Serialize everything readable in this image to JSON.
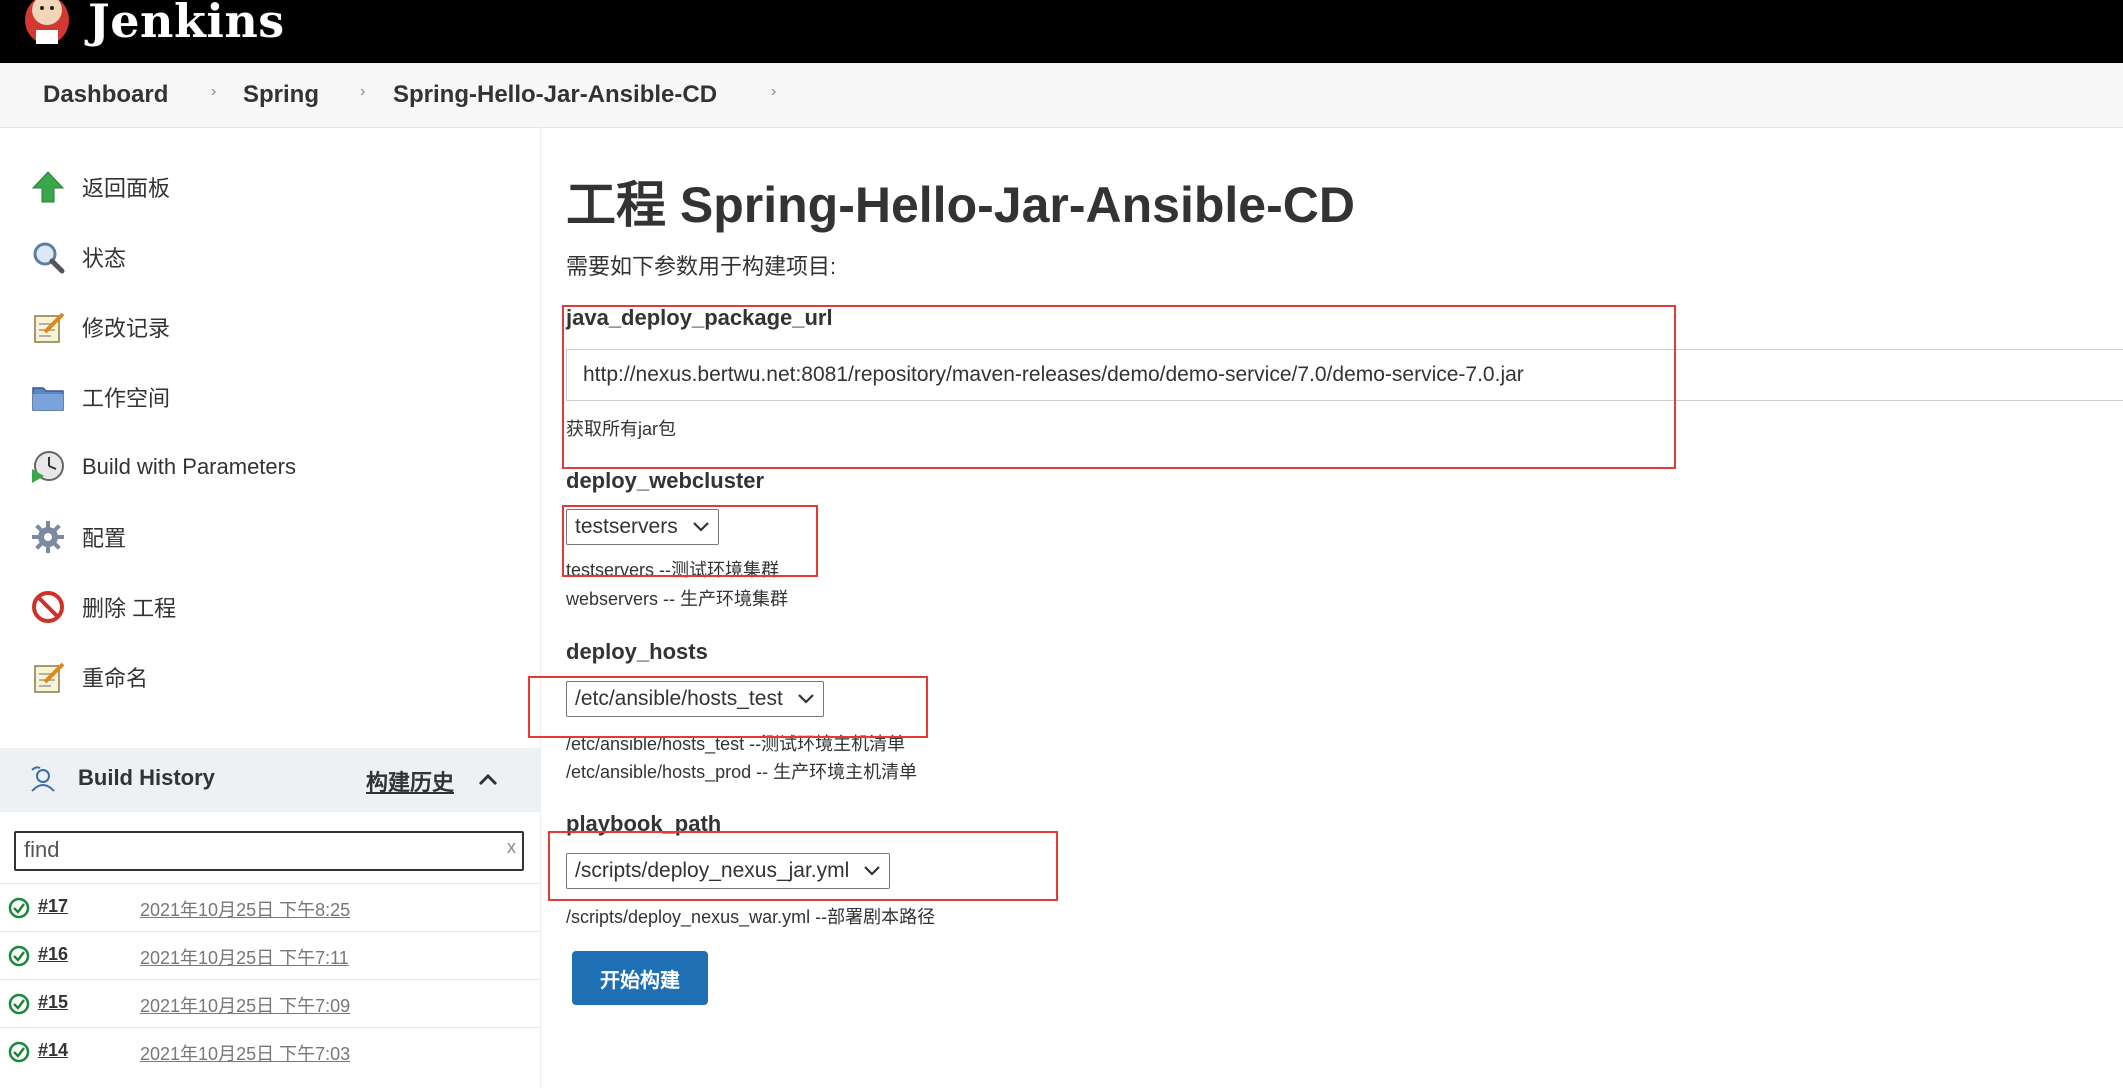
{
  "header": {
    "brand": "Jenkins"
  },
  "breadcrumb": [
    {
      "label": "Dashboard"
    },
    {
      "label": "Spring"
    },
    {
      "label": "Spring-Hello-Jar-Ansible-CD"
    }
  ],
  "sidebar": {
    "tasks": [
      {
        "label": "返回面板",
        "icon": "up-arrow-icon"
      },
      {
        "label": "状态",
        "icon": "magnifier-icon"
      },
      {
        "label": "修改记录",
        "icon": "notepad-icon"
      },
      {
        "label": "工作空间",
        "icon": "folder-icon"
      },
      {
        "label": "Build with Parameters",
        "icon": "clock-play-icon"
      },
      {
        "label": "配置",
        "icon": "gear-icon"
      },
      {
        "label": "删除 工程",
        "icon": "no-entry-icon"
      },
      {
        "label": "重命名",
        "icon": "notepad-pencil-icon"
      }
    ]
  },
  "build_history": {
    "title": "Build History",
    "trend_label": "构建历史",
    "search_placeholder": "find",
    "search_value": "find",
    "clear_label": "x",
    "builds": [
      {
        "number": "#17",
        "date": "2021年10月25日 下午8:25",
        "status": "success"
      },
      {
        "number": "#16",
        "date": "2021年10月25日 下午7:11",
        "status": "success"
      },
      {
        "number": "#15",
        "date": "2021年10月25日 下午7:09",
        "status": "success"
      },
      {
        "number": "#14",
        "date": "2021年10月25日 下午7:03",
        "status": "success"
      }
    ]
  },
  "main": {
    "title": "工程 Spring-Hello-Jar-Ansible-CD",
    "intro": "需要如下参数用于构建项目:",
    "params": {
      "url": {
        "name": "java_deploy_package_url",
        "value": "http://nexus.bertwu.net:8081/repository/maven-releases/demo/demo-service/7.0/demo-service-7.0.jar",
        "description": "获取所有jar包"
      },
      "webcluster": {
        "name": "deploy_webcluster",
        "selected": "testservers",
        "desc1": "testservers --测试环境集群",
        "desc2": "webservers -- 生产环境集群"
      },
      "hosts": {
        "name": "deploy_hosts",
        "selected": "/etc/ansible/hosts_test",
        "desc1": "/etc/ansible/hosts_test  --测试环境主机清单",
        "desc2": "/etc/ansible/hosts_prod -- 生产环境主机清单"
      },
      "playbook": {
        "name": "playbook_path",
        "selected": "/scripts/deploy_nexus_jar.yml",
        "desc1": "/scripts/deploy_nexus_war.yml  --部署剧本路径"
      }
    },
    "build_button": "开始构建"
  },
  "colors": {
    "header_bg": "#000000",
    "accent": "#1f6fb5",
    "highlight_box": "#e53935",
    "success": "#138a36"
  }
}
